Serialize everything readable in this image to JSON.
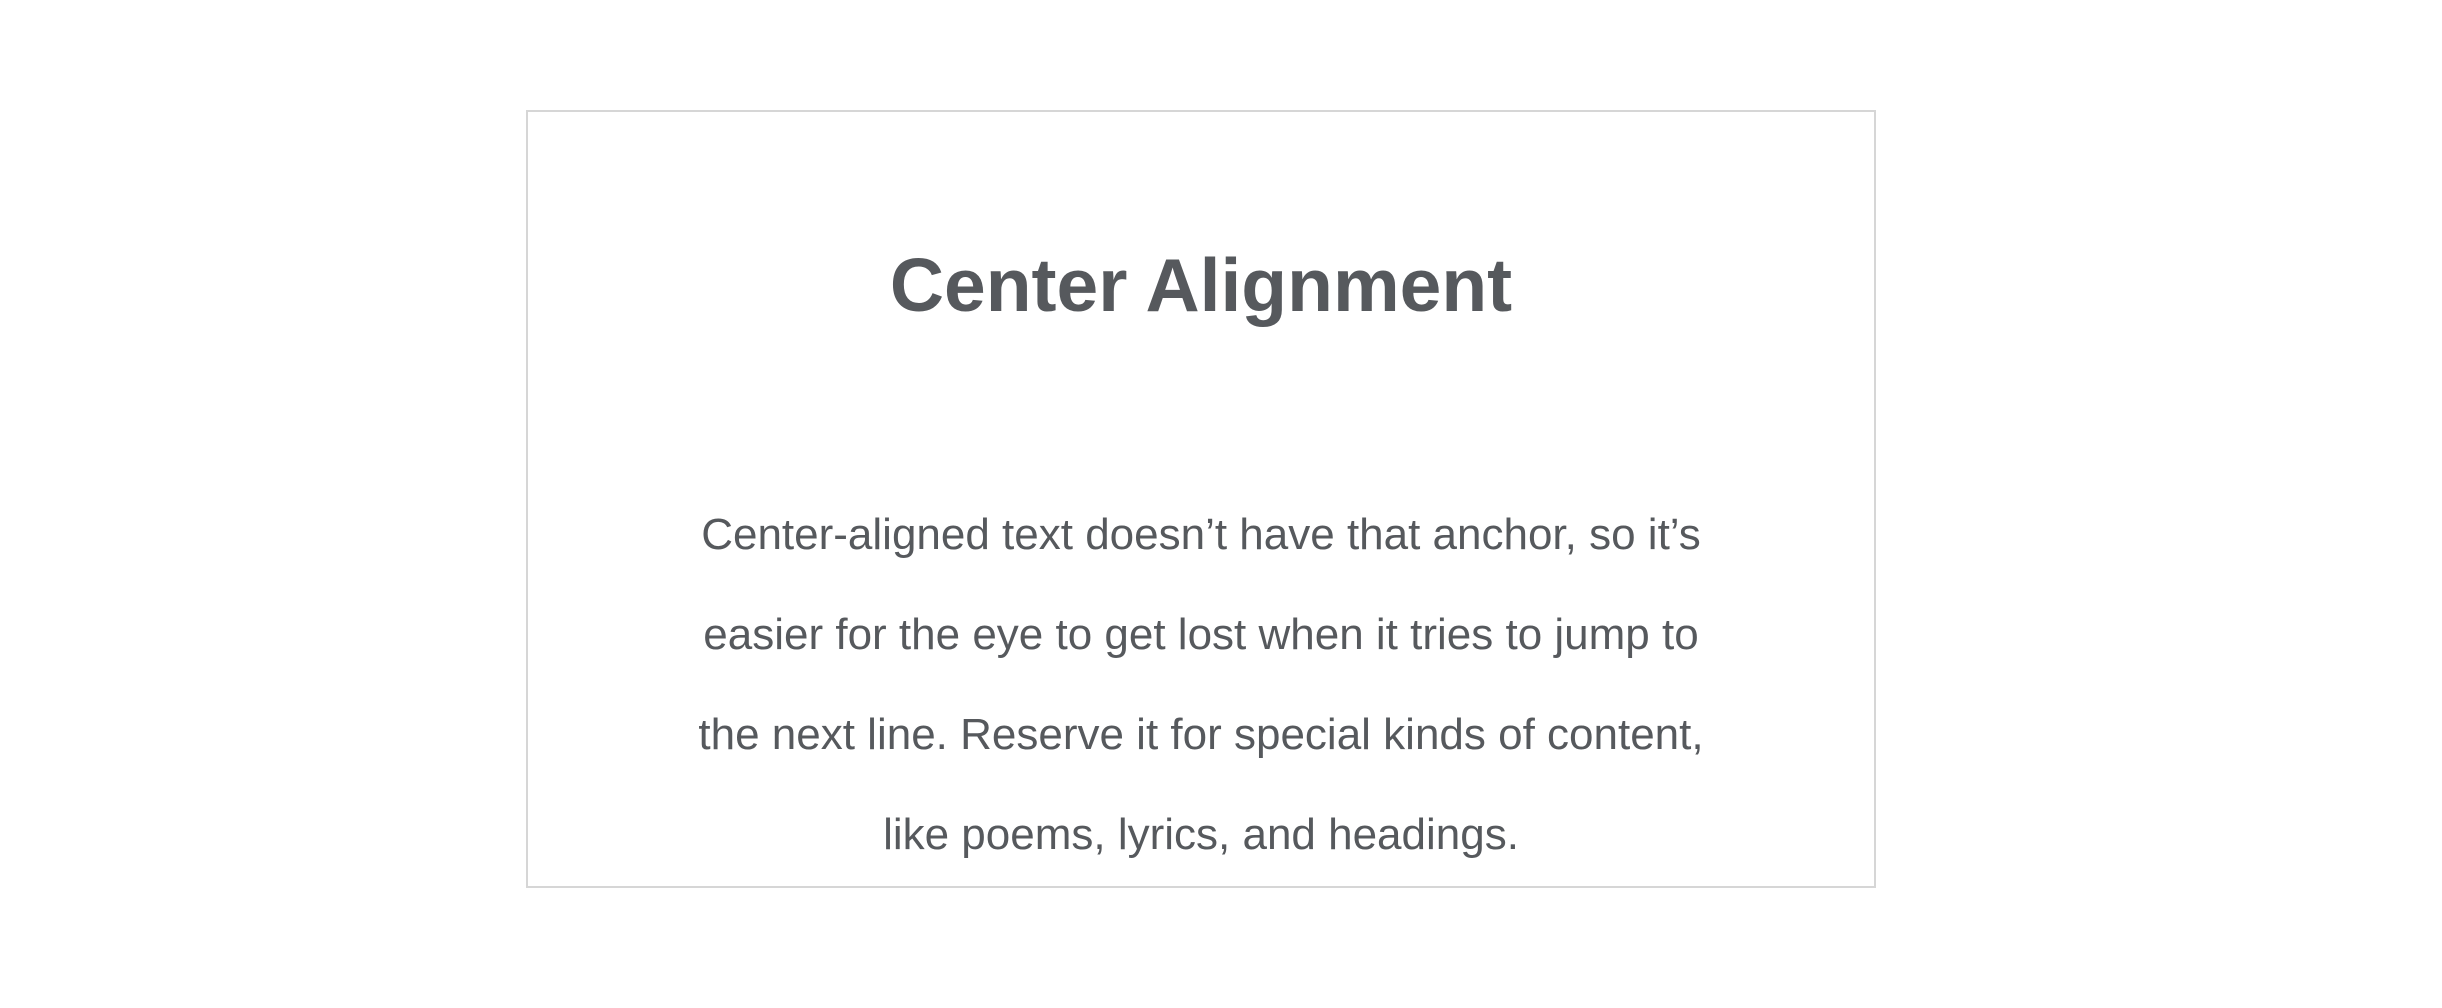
{
  "card": {
    "title": "Center Alignment",
    "body_lines": [
      "Center-aligned text doesn’t have that anchor, so it’s",
      "easier for the eye to get lost when it tries to jump to",
      "the next line. Reserve it for special kinds of content,",
      "like poems, lyrics, and headings."
    ]
  },
  "colors": {
    "text": "#56595d",
    "border": "#d6d6d6",
    "background": "#ffffff"
  }
}
